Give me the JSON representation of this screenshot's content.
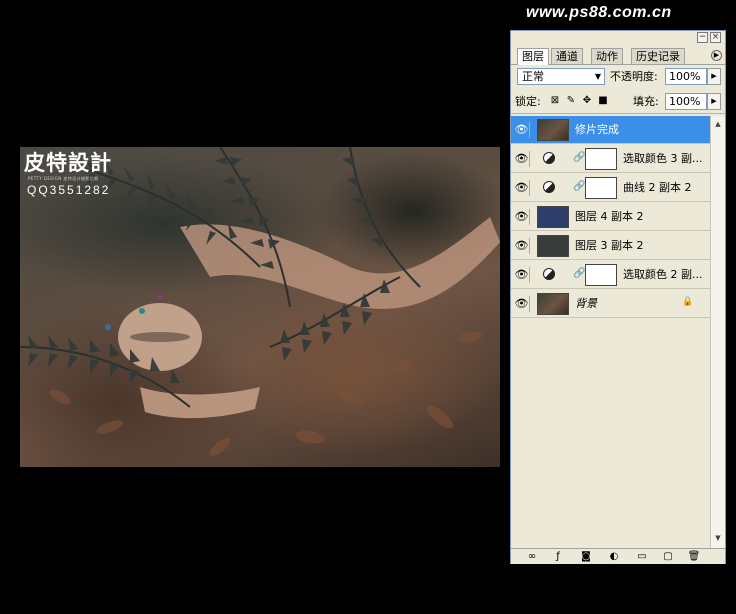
{
  "watermark": {
    "site": "www.ps88.com.cn"
  },
  "canvas": {
    "logo_text": "皮特設計",
    "logo_subtext": "PETTY DESIGN 皮特设计摄影后期",
    "qq_text": "QQ3551282"
  },
  "palette": {
    "title_buttons": {
      "minimize": "−",
      "close": "×"
    },
    "tabs": [
      {
        "label": "图层",
        "active": true
      },
      {
        "label": "通道",
        "active": false
      },
      {
        "label": "动作",
        "active": false
      },
      {
        "label": "历史记录",
        "active": false
      }
    ],
    "menu_arrow": "▶",
    "blend_mode": "正常",
    "opacity_label": "不透明度:",
    "opacity_value": "100%",
    "lock_label": "锁定:",
    "fill_label": "填充:",
    "fill_value": "100%",
    "layers": [
      {
        "name": "修片完成",
        "type": "photo",
        "selected": true,
        "visible": true
      },
      {
        "name": "选取颜色 3 副...",
        "type": "adjustment",
        "selected": false,
        "visible": true
      },
      {
        "name": "曲线 2 副本 2",
        "type": "adjustment",
        "selected": false,
        "visible": true
      },
      {
        "name": "图层 4 副本 2",
        "type": "fill",
        "color": "#2e3e6a",
        "selected": false,
        "visible": true
      },
      {
        "name": "图层 3 副本 2",
        "type": "fill",
        "color": "#383d3b",
        "selected": false,
        "visible": true
      },
      {
        "name": "选取颜色 2 副...",
        "type": "adjustment",
        "selected": false,
        "visible": true
      },
      {
        "name": "背景",
        "type": "background",
        "selected": false,
        "visible": true,
        "locked": true
      }
    ],
    "bottom_icons": [
      "link-icon",
      "layer-style-icon",
      "add-mask-icon",
      "new-adjustment-icon",
      "new-group-icon",
      "new-layer-icon",
      "delete-icon"
    ]
  },
  "colors": {
    "selection": "#3b8fe7",
    "panel": "#ece9d8"
  }
}
